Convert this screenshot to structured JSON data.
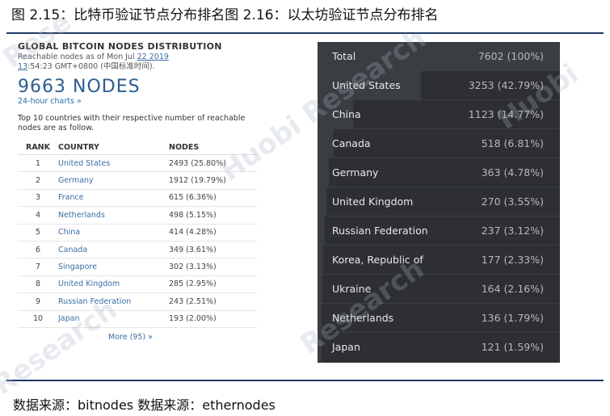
{
  "figure_title": "图 2.15：比特币验证节点分布排名图 2.16：以太坊验证节点分布排名",
  "source": "数据来源：bitnodes 数据来源：ethernodes",
  "watermark": [
    "Huobi Research",
    "Huobi",
    "Research",
    "Research",
    "Rese"
  ],
  "bitnodes": {
    "heading": "GLOBAL BITCOIN NODES DISTRIBUTION",
    "reachable_prefix": "Reachable nodes as of Mon Jul ",
    "reachable_link1": "22 2019",
    "reachable_link2": "13",
    "reachable_suffix": ":54:23 GMT+0800 (中国标准时间).",
    "total_nodes": "9663 NODES",
    "charts_link": "24-hour charts »",
    "top10_text": "Top 10 countries with their respective number of reachable nodes are as follow.",
    "columns": [
      "RANK",
      "COUNTRY",
      "NODES"
    ],
    "rows": [
      {
        "rank": "1",
        "country": "United States",
        "nodes": "2493 (25.80%)"
      },
      {
        "rank": "2",
        "country": "Germany",
        "nodes": "1912 (19.79%)"
      },
      {
        "rank": "3",
        "country": "France",
        "nodes": "615 (6.36%)"
      },
      {
        "rank": "4",
        "country": "Netherlands",
        "nodes": "498 (5.15%)"
      },
      {
        "rank": "5",
        "country": "China",
        "nodes": "414 (4.28%)"
      },
      {
        "rank": "6",
        "country": "Canada",
        "nodes": "349 (3.61%)"
      },
      {
        "rank": "7",
        "country": "Singapore",
        "nodes": "302 (3.13%)"
      },
      {
        "rank": "8",
        "country": "United Kingdom",
        "nodes": "285 (2.95%)"
      },
      {
        "rank": "9",
        "country": "Russian Federation",
        "nodes": "243 (2.51%)"
      },
      {
        "rank": "10",
        "country": "Japan",
        "nodes": "193 (2.00%)"
      }
    ],
    "more_link": "More (95) »"
  },
  "ethernodes": {
    "rows": [
      {
        "country": "Total",
        "value": "7602 (100%)",
        "share": 1.0
      },
      {
        "country": "United States",
        "value": "3253 (42.79%)",
        "share": 0.4279
      },
      {
        "country": "China",
        "value": "1123 (14.77%)",
        "share": 0.1477
      },
      {
        "country": "Canada",
        "value": "518 (6.81%)",
        "share": 0.0681
      },
      {
        "country": "Germany",
        "value": "363 (4.78%)",
        "share": 0.0478
      },
      {
        "country": "United Kingdom",
        "value": "270 (3.55%)",
        "share": 0.0355
      },
      {
        "country": "Russian Federation",
        "value": "237 (3.12%)",
        "share": 0.0312
      },
      {
        "country": "Korea, Republic of",
        "value": "177 (2.33%)",
        "share": 0.0233
      },
      {
        "country": "Ukraine",
        "value": "164 (2.16%)",
        "share": 0.0216
      },
      {
        "country": "Netherlands",
        "value": "136 (1.79%)",
        "share": 0.0179
      },
      {
        "country": "Japan",
        "value": "121 (1.59%)",
        "share": 0.0159
      }
    ]
  }
}
